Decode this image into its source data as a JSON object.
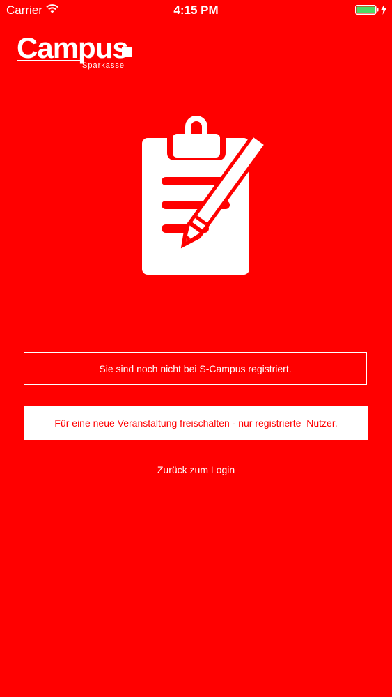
{
  "status_bar": {
    "carrier": "Carrier",
    "time": "4:15 PM",
    "wifi_icon": "wifi-icon",
    "battery_icon": "battery-icon",
    "charging_icon": "bolt-icon"
  },
  "logo": {
    "wordmark": "Campus",
    "subtitle": "Sparkasse"
  },
  "illustration": {
    "icon": "clipboard-pencil-icon"
  },
  "message": {
    "text": "Sie sind noch nicht bei S-Campus registriert."
  },
  "unlock_button": {
    "label": "Für eine neue Veranstaltung freischalten - nur registrierte  Nutzer."
  },
  "back_link": {
    "label": "Zurück zum Login"
  },
  "colors": {
    "background": "#ff0000",
    "foreground": "#ffffff",
    "battery": "#4cd964"
  }
}
